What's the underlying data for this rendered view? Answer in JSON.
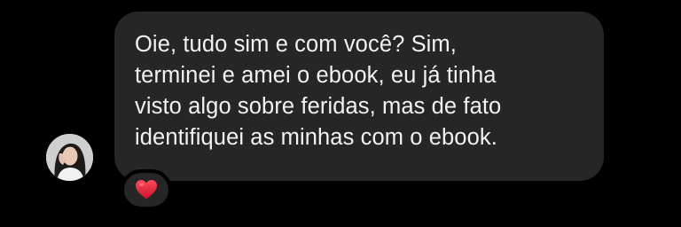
{
  "message": {
    "text": "Oie, tudo sim e com você? Sim,\nterminei e amei o ebook, eu já tinha\nvisto algo sobre feridas, mas de fato\nidentifiquei as minhas com o ebook.",
    "reaction_icon": "red-heart-icon",
    "sender_avatar_icon": "profile-photo-avatar"
  },
  "colors": {
    "background": "#000000",
    "bubble": "#262626",
    "text": "#f2f2f2",
    "heart": "#e0202f"
  }
}
